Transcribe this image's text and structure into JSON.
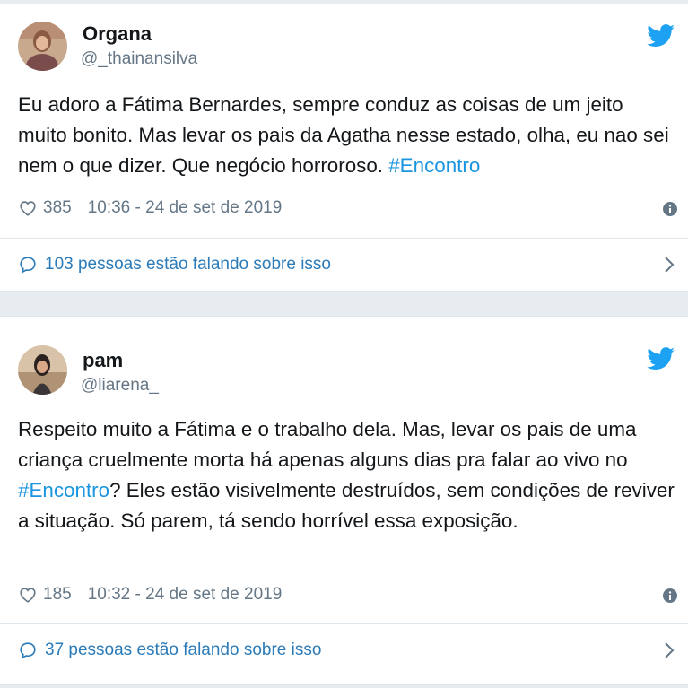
{
  "tweets": [
    {
      "display_name": "Organa",
      "handle": "@_thainansilva",
      "avatar_icon": "profile-photo",
      "brand_icon": "twitter-bird-icon",
      "text_before": "Eu adoro a Fátima Bernardes, sempre conduz as coisas de um jeito muito bonito. Mas levar os pais da Agatha nesse estado, olha, eu nao sei nem o que dizer. Que negócio horroroso. ",
      "hashtag": "#Encontro",
      "text_after": "",
      "likes": "385",
      "timestamp": "10:36 - 24 de set de 2019",
      "conversation": "103 pessoas estão falando sobre isso"
    },
    {
      "display_name": "pam",
      "handle": "@liarena_",
      "avatar_icon": "profile-photo",
      "brand_icon": "twitter-bird-icon",
      "text_before": "Respeito muito a Fátima e o trabalho dela. Mas, levar os pais de uma criança cruelmente morta há apenas alguns dias pra falar ao vivo no ",
      "hashtag": "#Encontro",
      "text_after": "? Eles estão visivelmente destruídos, sem condições de reviver a situação. Só parem, tá sendo horrível essa exposição.",
      "likes": "185",
      "timestamp": "10:32 - 24 de set de 2019",
      "conversation": "37 pessoas estão falando sobre isso"
    }
  ],
  "colors": {
    "link": "#1b95e0",
    "conversation": "#2b7bb9",
    "secondary_text": "#657786",
    "background": "#e6ecf0"
  }
}
